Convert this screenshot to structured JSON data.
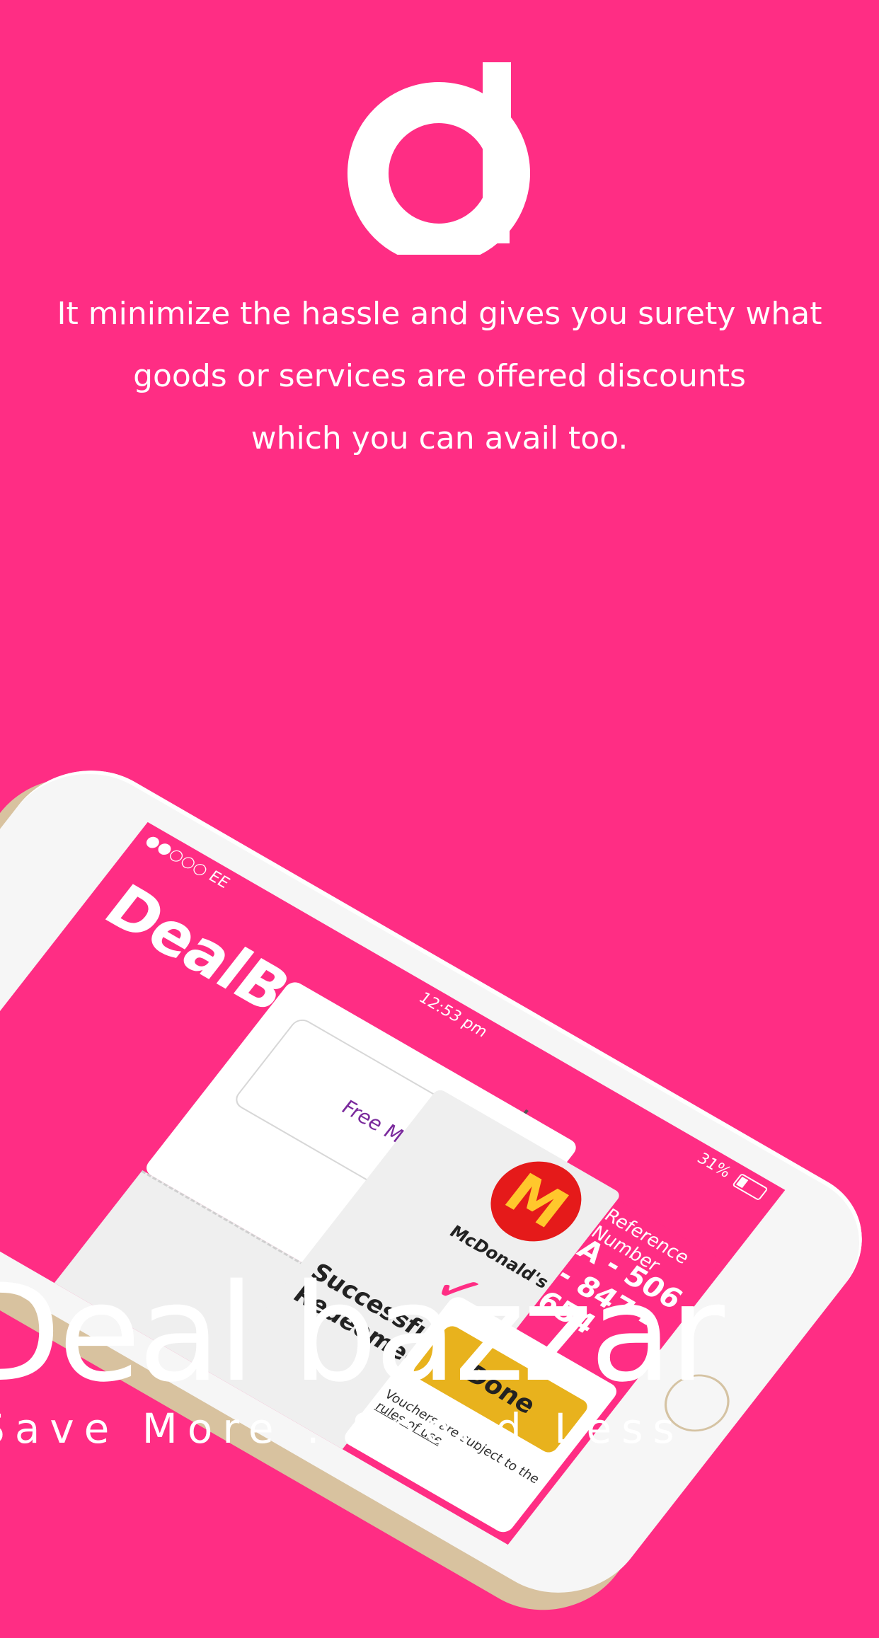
{
  "brand": {
    "tagline_lines": [
      "It minimize the hassle and gives you surety what",
      "goods or services are offered discounts",
      "which you can avail too."
    ],
    "wordmark": "Deal bazzar",
    "slogan": "Save More . Spend Less"
  },
  "phone": {
    "status": {
      "carrier": "●●○○○ EE",
      "time": "12:53 pm",
      "battery": "31%"
    },
    "app_title": "DealBazzar",
    "add_icon": "+",
    "search_value": "Free Meal",
    "merchant": {
      "logo": "M",
      "name": "McDonald's"
    },
    "status_title": "Successfully Redeemed",
    "reference_label": "Reference Number",
    "reference_number": "A - 506 - 847 - 654",
    "done_label": "Done",
    "rules_text": "Vouchers are subject to the",
    "rules_link": "rules of use"
  },
  "colors": {
    "background": "#ff2d84",
    "accent_yellow": "#e8b21d",
    "mcdonalds_red": "#e51a1a"
  }
}
